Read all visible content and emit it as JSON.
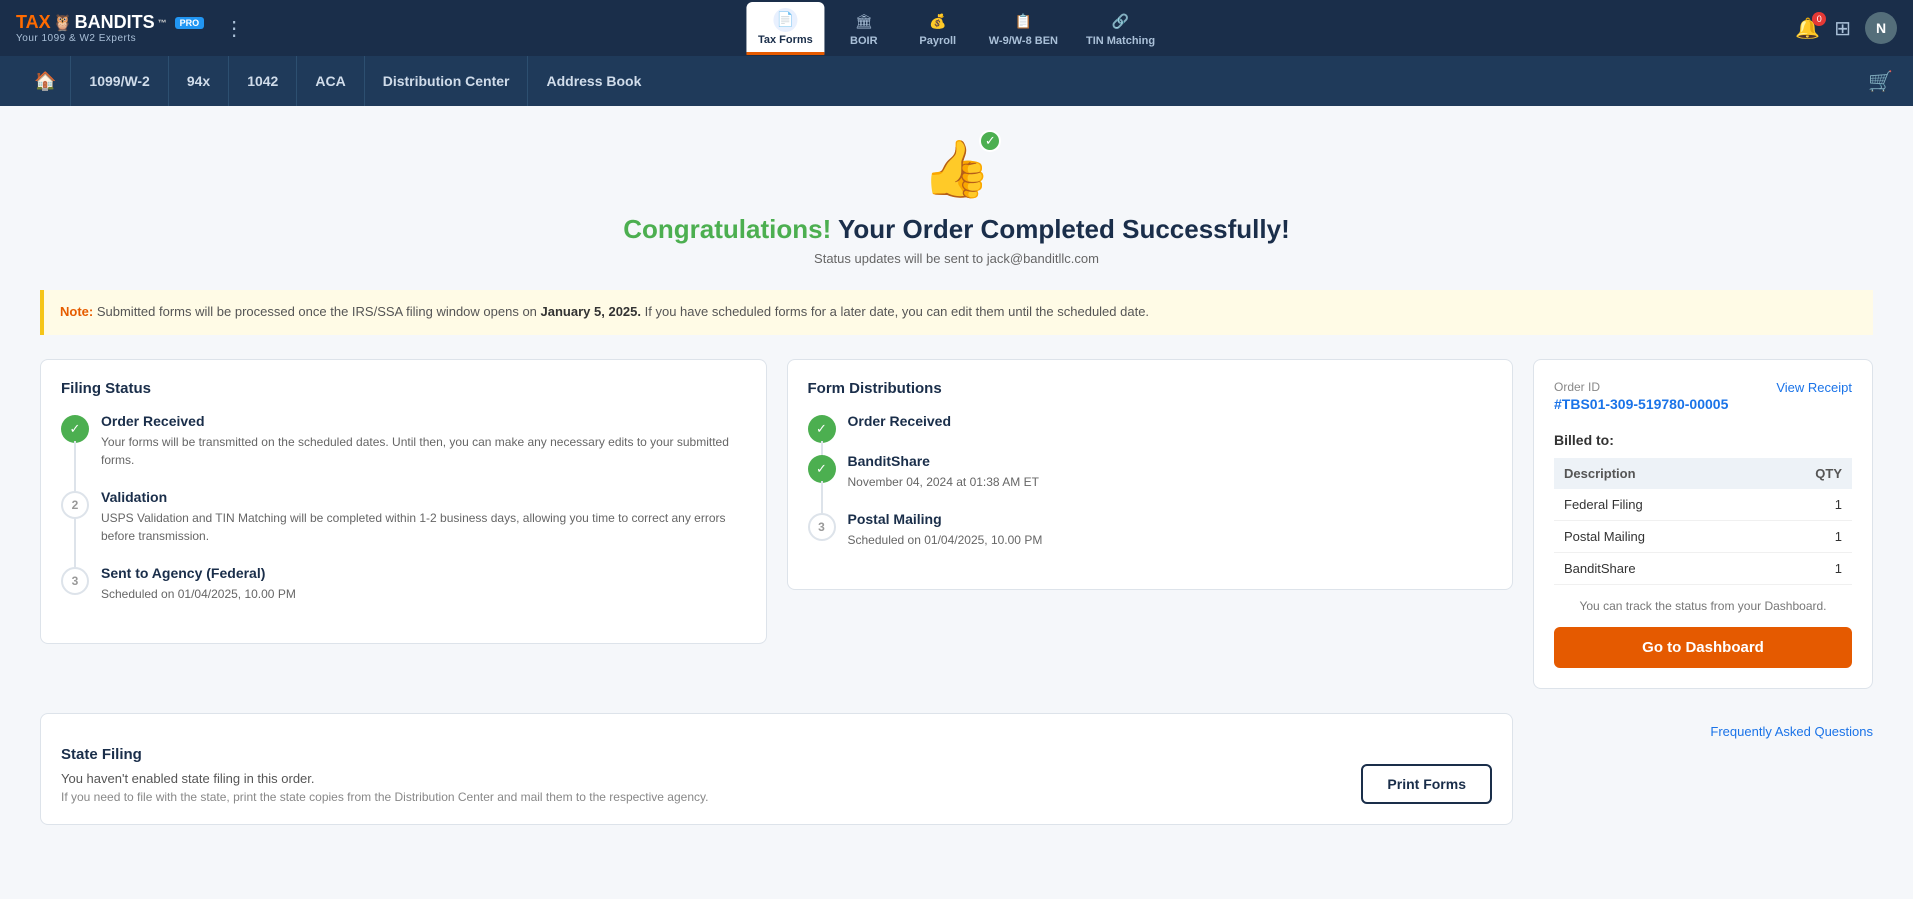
{
  "brand": {
    "tax": "TAX",
    "owl": "🦉",
    "bandits": "BANDITS",
    "tm": "™",
    "pro": "PRO",
    "tagline": "Your 1099 & W2 Experts"
  },
  "top_tabs": [
    {
      "id": "tax-forms",
      "label": "Tax Forms",
      "icon": "📄",
      "active": true
    },
    {
      "id": "boir",
      "label": "BOIR",
      "icon": "🏛",
      "active": false
    },
    {
      "id": "payroll",
      "label": "Payroll",
      "icon": "💰",
      "active": false
    },
    {
      "id": "w9-ben",
      "label": "W-9/W-8 BEN",
      "icon": "📋",
      "active": false
    },
    {
      "id": "tin",
      "label": "TIN Matching",
      "icon": "🔗",
      "active": false
    }
  ],
  "notifications": {
    "count": "0"
  },
  "avatar": {
    "letter": "N"
  },
  "sec_nav": {
    "items": [
      {
        "id": "home",
        "label": "🏠"
      },
      {
        "id": "1099",
        "label": "1099/W-2"
      },
      {
        "id": "94x",
        "label": "94x"
      },
      {
        "id": "1042",
        "label": "1042"
      },
      {
        "id": "aca",
        "label": "ACA"
      },
      {
        "id": "dist-center",
        "label": "Distribution Center"
      },
      {
        "id": "address-book",
        "label": "Address Book"
      }
    ]
  },
  "success": {
    "title_highlight": "Congratulations!",
    "title_rest": " Your Order Completed Successfully!",
    "status_email": "Status updates will be sent to jack@banditllc.com"
  },
  "note": {
    "label": "Note:",
    "text": " Submitted forms will be processed once the IRS/SSA filing window opens on ",
    "date": "January 5, 2025.",
    "suffix": " If you have scheduled forms for a later date, you can edit them until the scheduled date."
  },
  "filing_status": {
    "title": "Filing Status",
    "steps": [
      {
        "id": "order-received",
        "status": "done",
        "number": "1",
        "title": "Order Received",
        "desc": "Your forms will be transmitted on the scheduled dates. Until then, you can make any necessary edits to your submitted forms."
      },
      {
        "id": "validation",
        "status": "pending",
        "number": "2",
        "title": "Validation",
        "desc": "USPS Validation and TIN Matching will be completed within 1-2 business days, allowing you time to correct any errors before transmission."
      },
      {
        "id": "sent-agency",
        "status": "pending",
        "number": "3",
        "title": "Sent to Agency (Federal)",
        "desc": "Scheduled on 01/04/2025, 10.00 PM"
      }
    ]
  },
  "form_distributions": {
    "title": "Form Distributions",
    "steps": [
      {
        "id": "order-received",
        "status": "done",
        "number": "1",
        "title": "Order Received",
        "desc": ""
      },
      {
        "id": "banditshare",
        "status": "done",
        "number": "2",
        "title": "BanditShare",
        "desc": "November 04, 2024 at 01:38 AM ET"
      },
      {
        "id": "postal-mailing",
        "status": "pending",
        "number": "3",
        "title": "Postal Mailing",
        "desc": "Scheduled on 01/04/2025, 10.00 PM"
      }
    ]
  },
  "order_summary": {
    "order_id_label": "Order ID",
    "order_id": "#TBS01-309-519780-00005",
    "view_receipt": "View Receipt",
    "billed_to": "Billed to:",
    "columns": [
      "Description",
      "QTY"
    ],
    "rows": [
      {
        "desc": "Federal Filing",
        "qty": "1"
      },
      {
        "desc": "Postal Mailing",
        "qty": "1"
      },
      {
        "desc": "BanditShare",
        "qty": "1"
      }
    ],
    "track_note": "You can track the status from your Dashboard.",
    "dashboard_btn": "Go to Dashboard"
  },
  "state_filing": {
    "title": "State Filing",
    "desc": "You haven't enabled state filing in this order.",
    "note": "If you need to file with the state, print the state copies from the Distribution Center and mail them to the respective agency.",
    "print_btn": "Print Forms"
  },
  "faq": {
    "label": "Frequently Asked Questions"
  }
}
